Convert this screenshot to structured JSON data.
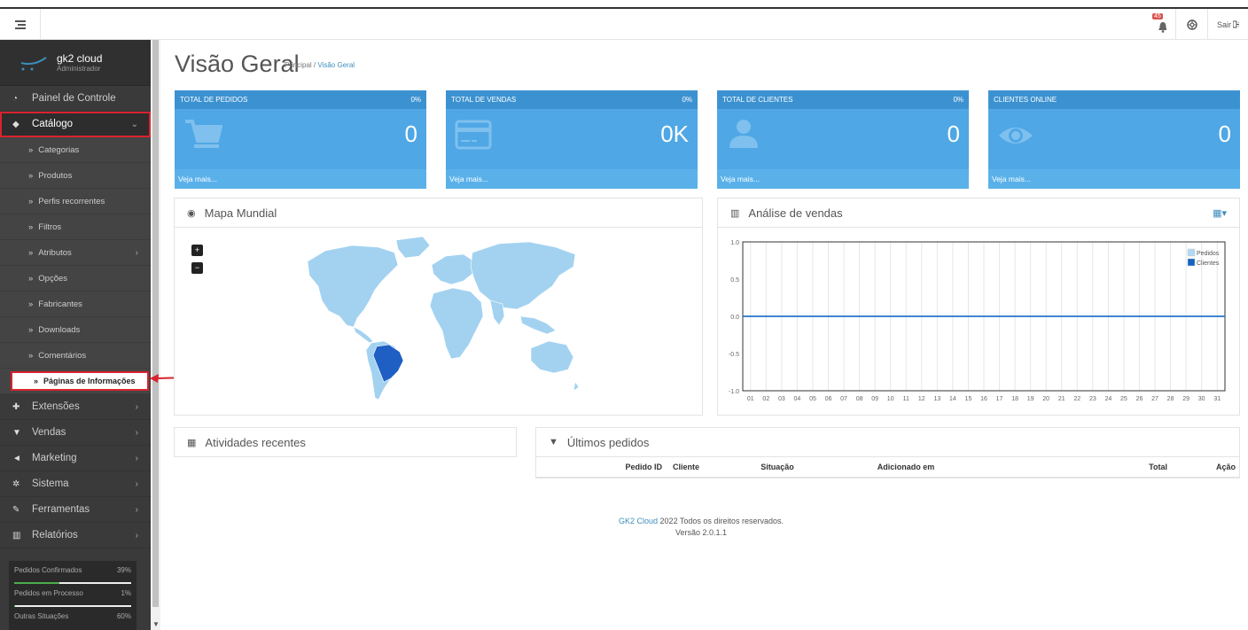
{
  "header": {
    "notification_count": "45",
    "logout_label": "Sair"
  },
  "profile": {
    "name": "gk2 cloud",
    "role": "Administrador"
  },
  "sidebar": {
    "items": [
      {
        "label": "Painel de Controle"
      },
      {
        "label": "Catálogo"
      },
      {
        "label": "Extensões"
      },
      {
        "label": "Vendas"
      },
      {
        "label": "Marketing"
      },
      {
        "label": "Sistema"
      },
      {
        "label": "Ferramentas"
      },
      {
        "label": "Relatórios"
      }
    ],
    "catalog_sub": [
      {
        "label": "Categorias"
      },
      {
        "label": "Produtos"
      },
      {
        "label": "Perfis recorrentes"
      },
      {
        "label": "Filtros"
      },
      {
        "label": "Atributos"
      },
      {
        "label": "Opções"
      },
      {
        "label": "Fabricantes"
      },
      {
        "label": "Downloads"
      },
      {
        "label": "Comentários"
      },
      {
        "label": "Páginas de Informações"
      }
    ],
    "stats": [
      {
        "label": "Pedidos Confirmados",
        "value": "39%",
        "fraction": 0.39
      },
      {
        "label": "Pedidos em Processo",
        "value": "1%",
        "fraction": 0.01
      },
      {
        "label": "Outras Situações",
        "value": "60%",
        "fraction": 0.6
      }
    ]
  },
  "page": {
    "title": "Visão Geral",
    "breadcrumb": {
      "home": "Principal",
      "sep": "/",
      "current": "Visão Geral"
    }
  },
  "tiles": [
    {
      "title": "TOTAL DE PEDIDOS",
      "percent": "0%",
      "value": "0",
      "link": "Veja mais..."
    },
    {
      "title": "TOTAL DE VENDAS",
      "percent": "0%",
      "value": "0K",
      "link": "Veja mais..."
    },
    {
      "title": "TOTAL DE CLIENTES",
      "percent": "0%",
      "value": "0",
      "link": "Veja mais..."
    },
    {
      "title": "CLIENTES ONLINE",
      "percent": "",
      "value": "0",
      "link": "Veja mais..."
    }
  ],
  "map_panel": {
    "title": "Mapa Mundial",
    "zoom_in": "+",
    "zoom_out": "−"
  },
  "sales_panel": {
    "title": "Análise de vendas"
  },
  "chart_data": {
    "type": "line",
    "title": "",
    "x": [
      "01",
      "02",
      "03",
      "04",
      "05",
      "06",
      "07",
      "08",
      "09",
      "10",
      "11",
      "12",
      "13",
      "14",
      "15",
      "16",
      "17",
      "18",
      "19",
      "20",
      "21",
      "22",
      "23",
      "24",
      "25",
      "26",
      "27",
      "28",
      "29",
      "30",
      "31"
    ],
    "series": [
      {
        "name": "Pedidos",
        "values": [
          0,
          0,
          0,
          0,
          0,
          0,
          0,
          0,
          0,
          0,
          0,
          0,
          0,
          0,
          0,
          0,
          0,
          0,
          0,
          0,
          0,
          0,
          0,
          0,
          0,
          0,
          0,
          0,
          0,
          0,
          0
        ],
        "color": "#b0d8f5"
      },
      {
        "name": "Clientes",
        "values": [
          0,
          0,
          0,
          0,
          0,
          0,
          0,
          0,
          0,
          0,
          0,
          0,
          0,
          0,
          0,
          0,
          0,
          0,
          0,
          0,
          0,
          0,
          0,
          0,
          0,
          0,
          0,
          0,
          0,
          0,
          0
        ],
        "color": "#1065c0"
      }
    ],
    "yticks": [
      "1.0",
      "0.5",
      "0.0",
      "-0.5",
      "-1.0"
    ],
    "ylim": [
      -1,
      1
    ],
    "grid": true,
    "legend": "top-right"
  },
  "activity_panel": {
    "title": "Atividades recentes"
  },
  "orders_panel": {
    "title": "Últimos pedidos",
    "columns": [
      "Pedido ID",
      "Cliente",
      "Situação",
      "Adicionado em",
      "Total",
      "Ação"
    ]
  },
  "footer": {
    "brand": "GK2 Cloud",
    "text": " 2022 Todos os direitos reservados.",
    "version": "Versão 2.0.1.1"
  },
  "colors": {
    "accent": "#4fa7e5",
    "highlight": "#d9232e",
    "map_land": "#a3d2f0",
    "map_selected": "#1f5fc4"
  }
}
